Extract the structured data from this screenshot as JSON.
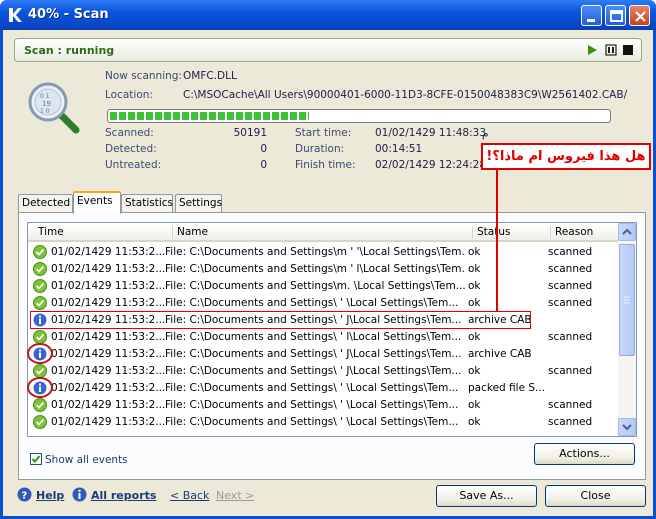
{
  "window": {
    "title": "40% - Scan"
  },
  "status": {
    "text": "Scan : running",
    "play_icon": "play-icon",
    "pause_icon": "pause-icon",
    "stop_icon": "stop-icon",
    "accent": "#2e6b1c"
  },
  "scan": {
    "now_scanning_label": "Now scanning:",
    "now_scanning": "OMFC.DLL",
    "location_label": "Location:",
    "location": "C:\\MSOCache\\All Users\\90000401-6000-11D3-8CFE-0150048383C9\\W2561402.CAB/",
    "progress_percent": 40,
    "scanned_label": "Scanned:",
    "scanned": "50191",
    "detected_label": "Detected:",
    "detected": "0",
    "untreated_label": "Untreated:",
    "untreated": "0",
    "start_label": "Start time:",
    "start": "01/02/1429 11:48:33",
    "start_suffix": "م",
    "duration_label": "Duration:",
    "duration": "00:14:51",
    "finish_label": "Finish time:",
    "finish": "02/02/1429 12:24:28"
  },
  "annotation": {
    "text": "هل هذا فيروس ام ماذا؟!",
    "color": "#e00000"
  },
  "tabs": [
    {
      "label": "Detected"
    },
    {
      "label": "Events",
      "active": true
    },
    {
      "label": "Statistics"
    },
    {
      "label": "Settings"
    }
  ],
  "table": {
    "columns": [
      "Time",
      "Name",
      "Status",
      "Reason"
    ],
    "rows": [
      {
        "icon": "ok",
        "time": "01/02/1429 11:53:2...",
        "name": "File: C:\\Documents and Settings\\m  '  '\\Local Settings\\Tem...",
        "status": "ok",
        "reason": "scanned"
      },
      {
        "icon": "ok",
        "time": "01/02/1429 11:53:2...",
        "name": "File: C:\\Documents and Settings\\m  '  l\\Local Settings\\Tem...",
        "status": "ok",
        "reason": "scanned"
      },
      {
        "icon": "ok",
        "time": "01/02/1429 11:53:2...",
        "name": "File: C:\\Documents and Settings\\m.     \\Local Settings\\Tem...",
        "status": "ok",
        "reason": "scanned"
      },
      {
        "icon": "ok",
        "time": "01/02/1429 11:53:2...",
        "name": "File: C:\\Documents and Settings\\    '  \\Local Settings\\Tem...",
        "status": "ok",
        "reason": "scanned"
      },
      {
        "icon": "info",
        "time": "01/02/1429 11:53:2...",
        "name": "File: C:\\Documents and Settings\\    '  J\\Local Settings\\Tem...",
        "status": "archive CAB",
        "reason": ""
      },
      {
        "icon": "ok",
        "time": "01/02/1429 11:53:2...",
        "name": "File: C:\\Documents and Settings\\    '  l\\Local Settings\\Tem...",
        "status": "ok",
        "reason": "scanned"
      },
      {
        "icon": "info",
        "time": "01/02/1429 11:53:2...",
        "name": "File: C:\\Documents and Settings\\    '  J\\Local Settings\\Tem...",
        "status": "archive CAB",
        "reason": ""
      },
      {
        "icon": "ok",
        "time": "01/02/1429 11:53:2...",
        "name": "File: C:\\Documents and Settings\\    '  J\\Local Settings\\Tem...",
        "status": "ok",
        "reason": "scanned"
      },
      {
        "icon": "info",
        "time": "01/02/1429 11:53:2...",
        "name": "File: C:\\Documents and Settings\\    '   \\Local Settings\\Tem...",
        "status": "packed file S...",
        "reason": ""
      },
      {
        "icon": "ok",
        "time": "01/02/1429 11:53:2...",
        "name": "File: C:\\Documents and Settings\\    '   \\Local Settings\\Tem...",
        "status": "ok",
        "reason": "scanned"
      },
      {
        "icon": "ok",
        "time": "01/02/1429 11:53:2...",
        "name": "File: C:\\Documents and Settings\\    '   \\Local Settings\\Tem...",
        "status": "ok",
        "reason": "scanned"
      }
    ]
  },
  "show_all_events": {
    "label": "Show all events",
    "checked": true
  },
  "buttons": {
    "actions": "Actions...",
    "save_as": "Save As...",
    "close": "Close"
  },
  "footer": {
    "help": "Help",
    "all_reports": "All reports",
    "back": "< Back",
    "next": "Next >"
  }
}
